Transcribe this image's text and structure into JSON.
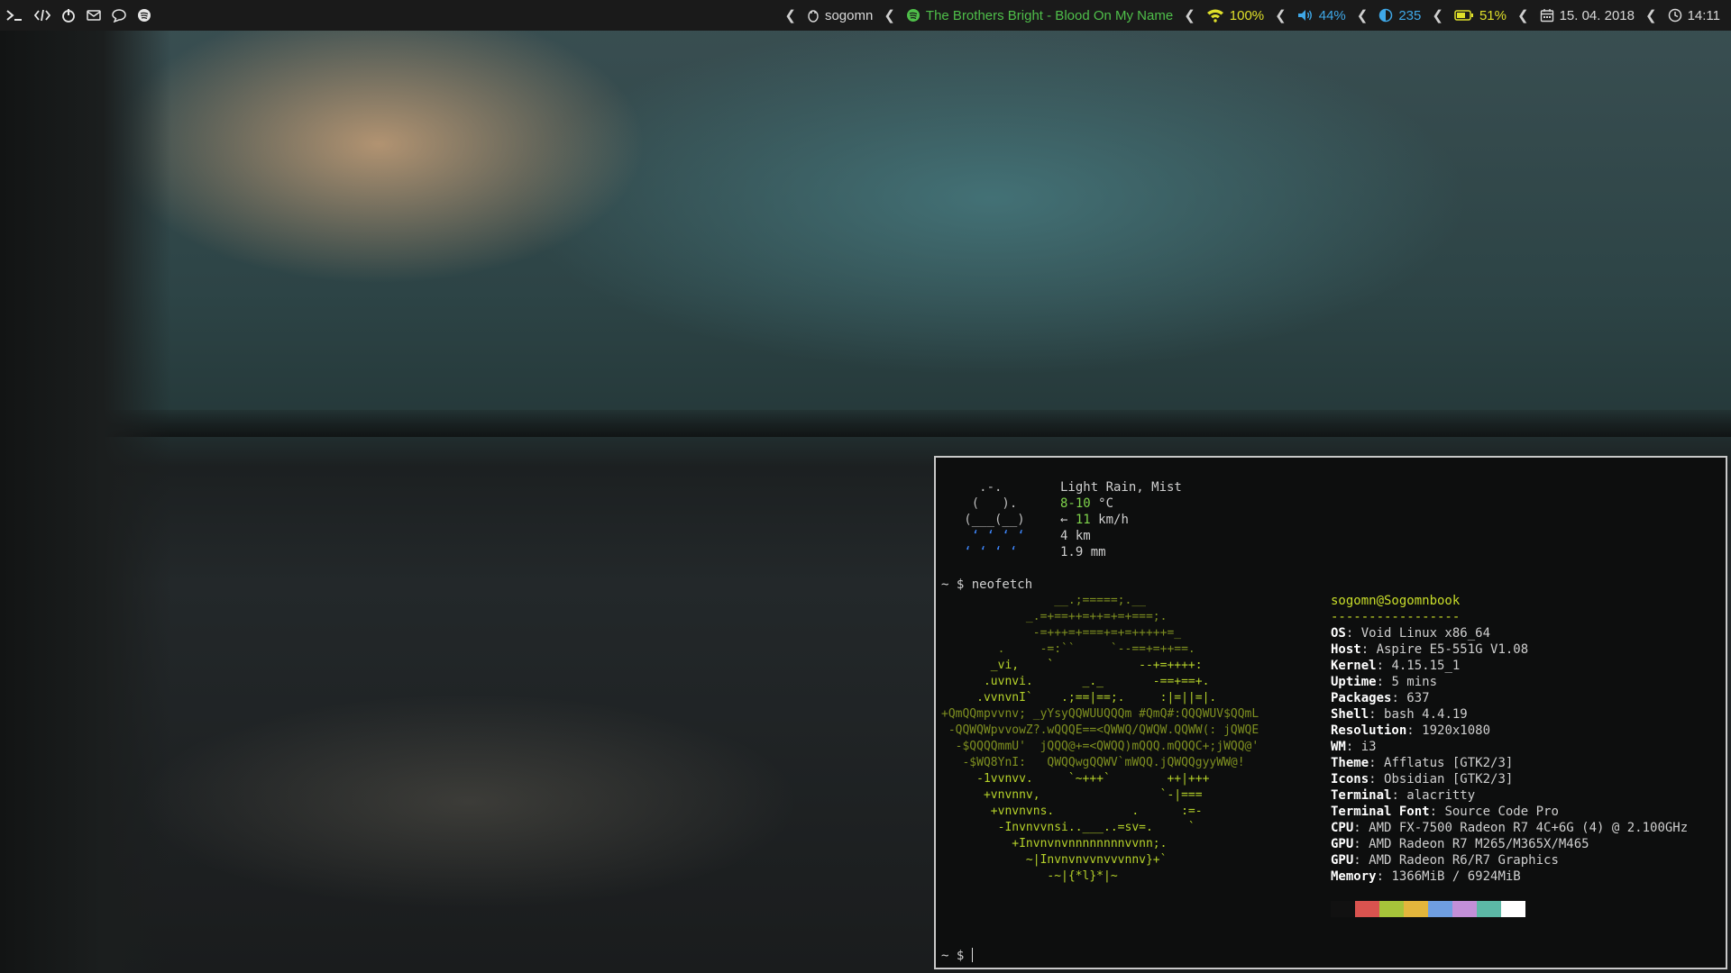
{
  "topbar": {
    "left_icons": [
      "terminal-icon",
      "code-icon",
      "power-icon",
      "mail-icon",
      "chat-icon",
      "spotify-icon"
    ],
    "user": "sogomn",
    "now_playing": "The Brothers Bright - Blood On My Name",
    "wifi": "100%",
    "volume": "44%",
    "brightness": "235",
    "battery": "51%",
    "date": "15. 04. 2018",
    "time": "14:11",
    "colors": {
      "background": "#1a1a1a",
      "green": "#4fbf4a",
      "blue": "#3fa8e8",
      "yellow": "#dfe02a"
    }
  },
  "terminal": {
    "weather": {
      "condition": "Light Rain, Mist",
      "temp_range": "8-10",
      "temp_unit": " °C",
      "wind_arrow": "←",
      "wind_speed": "11",
      "wind_unit": " km/h",
      "visibility": "4 km",
      "precipitation": "1.9 mm"
    },
    "prompt": "~ $ ",
    "command": "neofetch",
    "info": {
      "user_host": "sogomn@Sogomnbook",
      "separator": "-----------------",
      "rows": [
        {
          "key": "OS",
          "value": "Void Linux x86_64"
        },
        {
          "key": "Host",
          "value": "Aspire E5-551G V1.08"
        },
        {
          "key": "Kernel",
          "value": "4.15.15_1"
        },
        {
          "key": "Uptime",
          "value": "5 mins"
        },
        {
          "key": "Packages",
          "value": "637"
        },
        {
          "key": "Shell",
          "value": "bash 4.4.19"
        },
        {
          "key": "Resolution",
          "value": "1920x1080"
        },
        {
          "key": "WM",
          "value": "i3"
        },
        {
          "key": "Theme",
          "value": "Afflatus [GTK2/3]"
        },
        {
          "key": "Icons",
          "value": "Obsidian [GTK2/3]"
        },
        {
          "key": "Terminal",
          "value": "alacritty"
        },
        {
          "key": "Terminal Font",
          "value": "Source Code Pro"
        },
        {
          "key": "CPU",
          "value": "AMD FX-7500 Radeon R7 4C+6G (4) @ 2.100GHz"
        },
        {
          "key": "GPU",
          "value": "AMD Radeon R7 M265/M365X/M465"
        },
        {
          "key": "GPU",
          "value": "AMD Radeon R6/R7 Graphics"
        },
        {
          "key": "Memory",
          "value": "1366MiB / 6924MiB"
        }
      ]
    },
    "palette": [
      "#111111",
      "#d9534f",
      "#a6c43a",
      "#e3b63c",
      "#6f9ee0",
      "#c38fd8",
      "#5cb8a6",
      "#ffffff"
    ],
    "ascii_logo": [
      "                __.;=====;.__",
      "            _.=+==++=++=+=+===;.",
      "             -=+++=+===+=+=+++++=_",
      "        .     -=:``     `--==+=++==.",
      "       _vi,    `            --+=++++:",
      "      .uvnvi.       _._       -==+==+.",
      "     .vvnvnI`    .;==|==;.     :|=||=|.",
      "+QmQQmpvvnv; _yYsyQQWUUQQQm #QmQ#:QQQWUV$QQmL",
      " -QQWQWpvvowZ?.wQQQE==<QWWQ/QWQW.QQWW(: jQWQE",
      "  -$QQQQmmU'  jQQQ@+=<QWQQ)mQQQ.mQQQC+;jWQQ@'",
      "   -$WQ8YnI:   QWQQwgQQWV`mWQQ.jQWQQgyyWW@!",
      "     -1vvnvv.     `~+++`        ++|+++",
      "      +vnvnnv,                 `-|===",
      "       +vnvnvns.           .      :=-",
      "        -Invnvvnsi..___..=sv=.     `",
      "          +Invnvnvnnnnnnnnvvnn;.",
      "            ~|Invnvnvvnvvvnnv}+`",
      "               -~|{*l}*|~"
    ],
    "weather_art": [
      "     .-.",
      "    (   ).",
      "   (___(__)",
      "    ‘ ‘ ‘ ‘",
      "   ‘ ‘ ‘ ‘"
    ]
  }
}
